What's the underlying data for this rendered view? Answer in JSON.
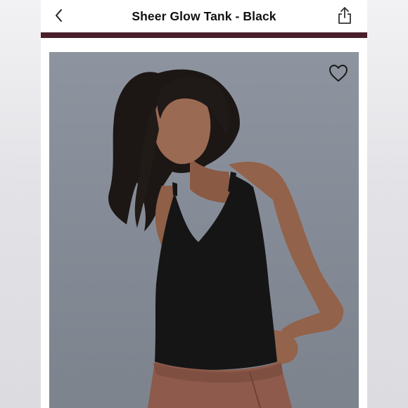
{
  "header": {
    "title": "Sheer Glow Tank - Black",
    "back_icon": "chevron-left-icon",
    "share_icon": "share-icon"
  },
  "product": {
    "favorite_icon": "heart-outline-icon",
    "image_subject": "model wearing black tank top"
  },
  "colors": {
    "accent": "#4a1f2c",
    "photo_background": "#858b96"
  }
}
